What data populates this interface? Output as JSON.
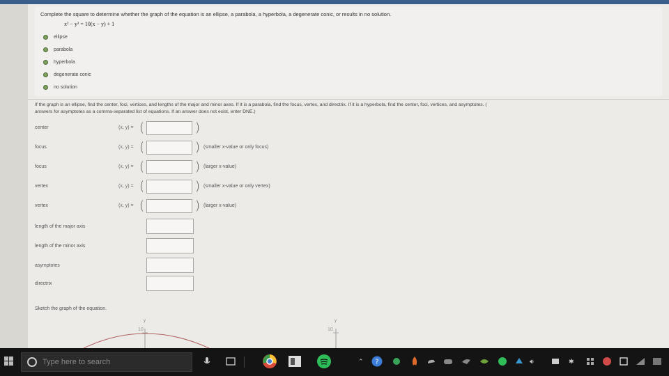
{
  "question1": {
    "prompt": "Complete the square to determine whether the graph of the equation is an ellipse, a parabola, a hyperbola, a degenerate conic, or results in no solution.",
    "equation": "x² − y² = 10(x − y) + 1",
    "options": [
      "ellipse",
      "parabola",
      "hyperbola",
      "degenerate conic",
      "no solution"
    ]
  },
  "question2": {
    "instructions_line1": "If the graph is an ellipse, find the center, foci, vertices, and lengths of the major and minor axes. If it is a parabola, find the focus, vertex, and directrix. If it is a hyperbola, find the center, foci, vertices, and asymptotes. (",
    "instructions_line2": "answers for asymptotes as a comma-separated list of equations. If an answer does not exist, enter DNE.)",
    "xy_label": "(x, y) =",
    "rows": [
      {
        "label": "center",
        "hint": ""
      },
      {
        "label": "focus",
        "hint": "(smaller x-value or only focus)"
      },
      {
        "label": "focus",
        "hint": "(larger x-value)"
      },
      {
        "label": "vertex",
        "hint": "(smaller x-value or only vertex)"
      },
      {
        "label": "vertex",
        "hint": "(larger x-value)"
      }
    ],
    "plain_rows": [
      {
        "label": "length of the major axis"
      },
      {
        "label": "length of the minor axis"
      },
      {
        "label": "asymptotes"
      },
      {
        "label": "directrix"
      }
    ]
  },
  "sketch": {
    "label": "Sketch the graph of the equation.",
    "axis_y": "y",
    "tick_label": "10"
  },
  "taskbar": {
    "search_placeholder": "Type here to search"
  },
  "colors": {
    "radio": "#7fa25b",
    "taskbar": "#141414",
    "page": "#ecebe8"
  }
}
